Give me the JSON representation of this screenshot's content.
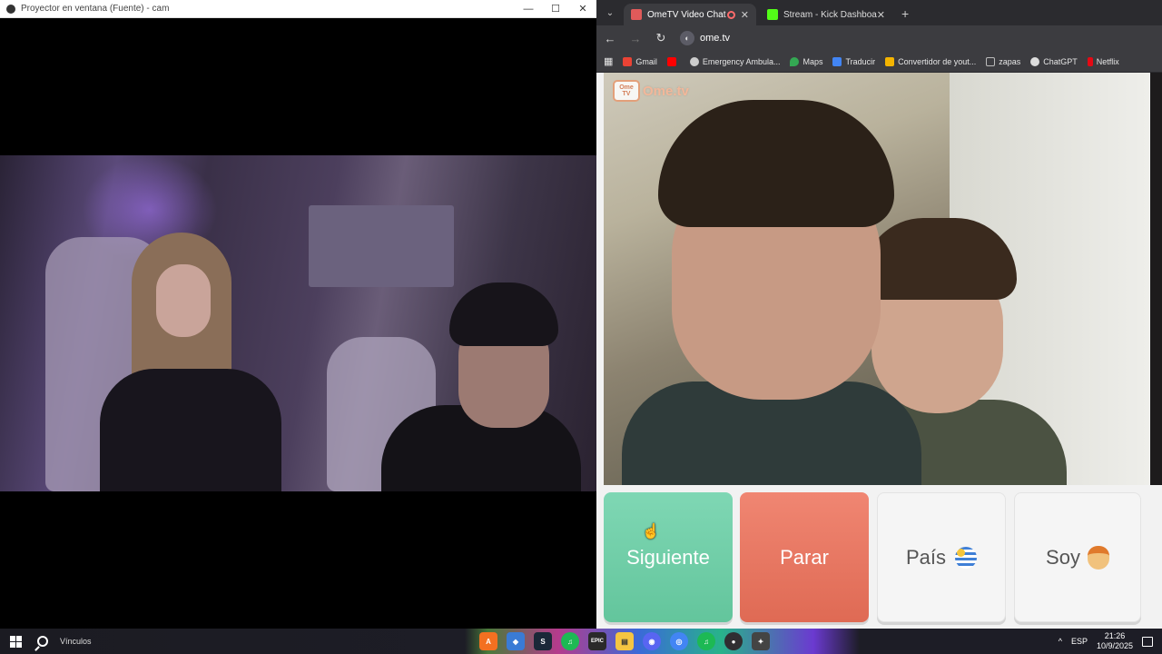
{
  "obs": {
    "title": "Proyector en ventana (Fuente) - cam",
    "controls": {
      "minimize": "—",
      "maximize": "☐",
      "close": "✕"
    }
  },
  "browser": {
    "tabs": [
      {
        "label": "OmeTV Video Chat — Ome",
        "active": true,
        "icon": "ometv-favicon",
        "color": "#e05a5a"
      },
      {
        "label": "Stream - Kick Dashboard",
        "active": false,
        "icon": "kick-favicon",
        "color": "#53fc18"
      }
    ],
    "tab_list_glyph": "⌄",
    "new_tab": "+",
    "tab_close": "✕",
    "nav": {
      "back": "←",
      "forward": "→",
      "reload": "↻"
    },
    "url": "ome.tv",
    "bookmarks": [
      {
        "label": "Gmail",
        "color": "#ea4335"
      },
      {
        "label": "",
        "color": "#ff0000"
      },
      {
        "label": "Emergency Ambula...",
        "color": "#cccccc"
      },
      {
        "label": "Maps",
        "color": "#34a853"
      },
      {
        "label": "Traducir",
        "color": "#4285f4"
      },
      {
        "label": "Convertidor de yout...",
        "color": "#f4b400"
      },
      {
        "label": "zapas",
        "color": "#bbbbbb"
      },
      {
        "label": "ChatGPT",
        "color": "#dddddd"
      },
      {
        "label": "Netflix",
        "color": "#e50914"
      }
    ]
  },
  "ometv": {
    "logo_badge": "Ome TV",
    "logo_text": "Ome.tv",
    "buttons": {
      "next": "Siguiente",
      "stop": "Parar",
      "country": "País",
      "gender": "Soy"
    }
  },
  "taskbar": {
    "search_label": "Vínculos",
    "apps": [
      {
        "name": "avast-app",
        "glyph": "A",
        "color": "#f37021"
      },
      {
        "name": "app-blue",
        "glyph": "◆",
        "color": "#3a7bd5"
      },
      {
        "name": "steam-app",
        "glyph": "S",
        "color": "#1b2838"
      },
      {
        "name": "spotify-app",
        "glyph": "♫",
        "color": "#1db954"
      },
      {
        "name": "epic-app",
        "glyph": "EPIC",
        "color": "#2a2a2a"
      },
      {
        "name": "explorer-app",
        "glyph": "▤",
        "color": "#f5c542"
      },
      {
        "name": "discord-app",
        "glyph": "◉",
        "color": "#5865f2"
      },
      {
        "name": "chrome-app",
        "glyph": "◎",
        "color": "#4285f4"
      },
      {
        "name": "spotify-app-2",
        "glyph": "♫",
        "color": "#1db954"
      },
      {
        "name": "obs-app",
        "glyph": "●",
        "color": "#302e31"
      },
      {
        "name": "app-misc",
        "glyph": "✦",
        "color": "#444444"
      }
    ],
    "tray": {
      "chevron": "^",
      "lang": "ESP",
      "time": "21:26",
      "date": "10/9/2025"
    }
  }
}
